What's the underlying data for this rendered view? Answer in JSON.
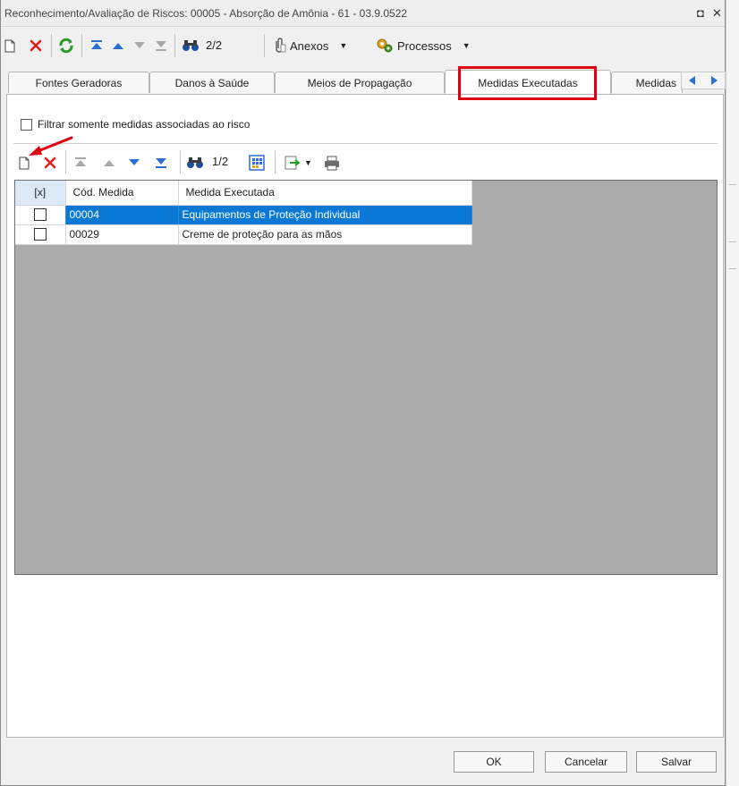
{
  "window": {
    "title": "Reconhecimento/Avaliação de Riscos: 00005 - Absorção de Amônia - 61 - 03.9.0522",
    "restore_glyph": "◘",
    "close_glyph": "✕"
  },
  "toolbar": {
    "record_counter": "2/2",
    "anexos_label": "Anexos",
    "processos_label": "Processos",
    "dropdown_glyph": "▼"
  },
  "tabs": [
    {
      "label": "Fontes Geradoras"
    },
    {
      "label": "Danos à Saúde"
    },
    {
      "label": "Meios de Propagação"
    },
    {
      "label": "Medidas Executadas"
    },
    {
      "label": "Medidas"
    }
  ],
  "active_tab": "Medidas Executadas",
  "filter": {
    "label": "Filtrar somente medidas associadas ao risco",
    "checked": false
  },
  "grid_toolbar": {
    "record_counter": "1/2",
    "dropdown_glyph": "▼"
  },
  "grid": {
    "columns": [
      "[x]",
      "Cód. Medida",
      "Medida Executada"
    ],
    "rows": [
      {
        "code": "00004",
        "name": "Equipamentos de Proteção Individual",
        "selected": true,
        "checked": false
      },
      {
        "code": "00029",
        "name": "Creme de proteção para as mãos",
        "selected": false,
        "checked": false
      }
    ]
  },
  "buttons": {
    "ok": "OK",
    "cancelar": "Cancelar",
    "salvar": "Salvar"
  },
  "colors": {
    "selection": "#0a79d6",
    "highlight": "#e0000f",
    "grid_background": "#ababab",
    "delete_red": "#e02020"
  }
}
